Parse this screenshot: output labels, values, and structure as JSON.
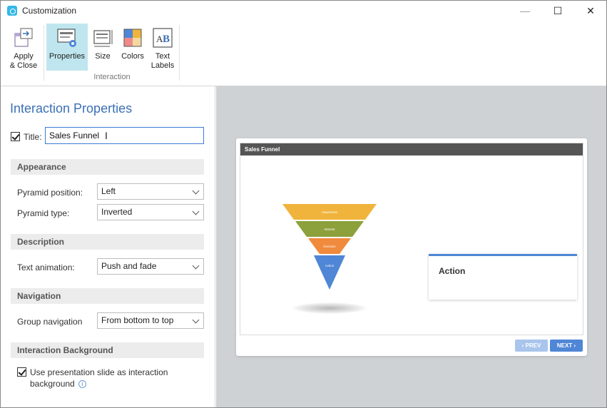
{
  "window": {
    "title": "Customization",
    "minimize_glyph": "—",
    "maximize_glyph": "☐",
    "close_glyph": "✕"
  },
  "ribbon": {
    "apply_close": {
      "line1": "Apply",
      "line2": "& Close",
      "icon": "apply-close-icon"
    },
    "group_label": "Interaction",
    "buttons": [
      {
        "line1": "Properties",
        "line2": "",
        "icon": "properties-icon",
        "active": true
      },
      {
        "line1": "Size",
        "line2": "",
        "icon": "size-icon"
      },
      {
        "line1": "Colors",
        "line2": "",
        "icon": "colors-icon"
      },
      {
        "line1": "Text",
        "line2": "Labels",
        "icon": "text-labels-icon"
      }
    ]
  },
  "panel": {
    "heading": "Interaction Properties",
    "title_label": "Title:",
    "title_value": "Sales Funnel",
    "title_checked": true,
    "sections": {
      "appearance": "Appearance",
      "description": "Description",
      "navigation": "Navigation",
      "background": "Interaction Background"
    },
    "fields": {
      "pyramid_position": {
        "label": "Pyramid position:",
        "value": "Left"
      },
      "pyramid_type": {
        "label": "Pyramid type:",
        "value": "Inverted"
      },
      "text_animation": {
        "label": "Text animation:",
        "value": "Push and fade"
      },
      "group_navigation": {
        "label": "Group navigation",
        "value": "From bottom to top"
      }
    },
    "background_option": {
      "line1": "Use presentation slide as interaction",
      "line2": "background",
      "checked": true
    }
  },
  "preview": {
    "slide_title": "Sales Funnel",
    "funnel_levels": [
      {
        "label": "Awareness",
        "color": "#f0b43c"
      },
      {
        "label": "Interest",
        "color": "#8ca03c"
      },
      {
        "label": "Decision",
        "color": "#f08a3c"
      },
      {
        "label": "Action",
        "color": "#4f86d6"
      }
    ],
    "callout_text": "Action",
    "prev_label": "‹ PREV",
    "next_label": "NEXT ›"
  },
  "colors": {
    "accent": "#3b70b6",
    "active_ribbon": "#bfe6ee",
    "input_border": "#3d7ad6",
    "preview_background": "#cfd2d5"
  }
}
